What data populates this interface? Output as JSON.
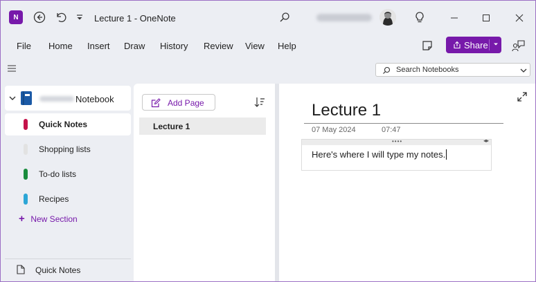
{
  "app": {
    "logo_text": "N",
    "title": "Lecture 1  -  OneNote"
  },
  "menu": {
    "items": [
      "File",
      "Home",
      "Insert",
      "Draw",
      "History",
      "Review",
      "View",
      "Help"
    ],
    "share_label": "Share"
  },
  "search": {
    "placeholder": "Search Notebooks"
  },
  "sidebar": {
    "notebook_name": "Notebook",
    "sections": [
      {
        "label": "Quick Notes",
        "color": "#c4124a",
        "selected": true
      },
      {
        "label": "Shopping lists",
        "color": "#e2e2e2",
        "selected": false
      },
      {
        "label": "To-do lists",
        "color": "#188b3c",
        "selected": false
      },
      {
        "label": "Recipes",
        "color": "#2ca6d6",
        "selected": false
      }
    ],
    "new_section_label": "New Section",
    "footer_label": "Quick Notes"
  },
  "pagelist": {
    "add_page_label": "Add Page",
    "pages": [
      {
        "label": "Lecture 1",
        "selected": true
      }
    ]
  },
  "page": {
    "title": "Lecture 1",
    "date": "07 May 2024",
    "time": "07:47",
    "note_text": "Here's where I will type my notes."
  },
  "colors": {
    "accent": "#7719aa"
  }
}
